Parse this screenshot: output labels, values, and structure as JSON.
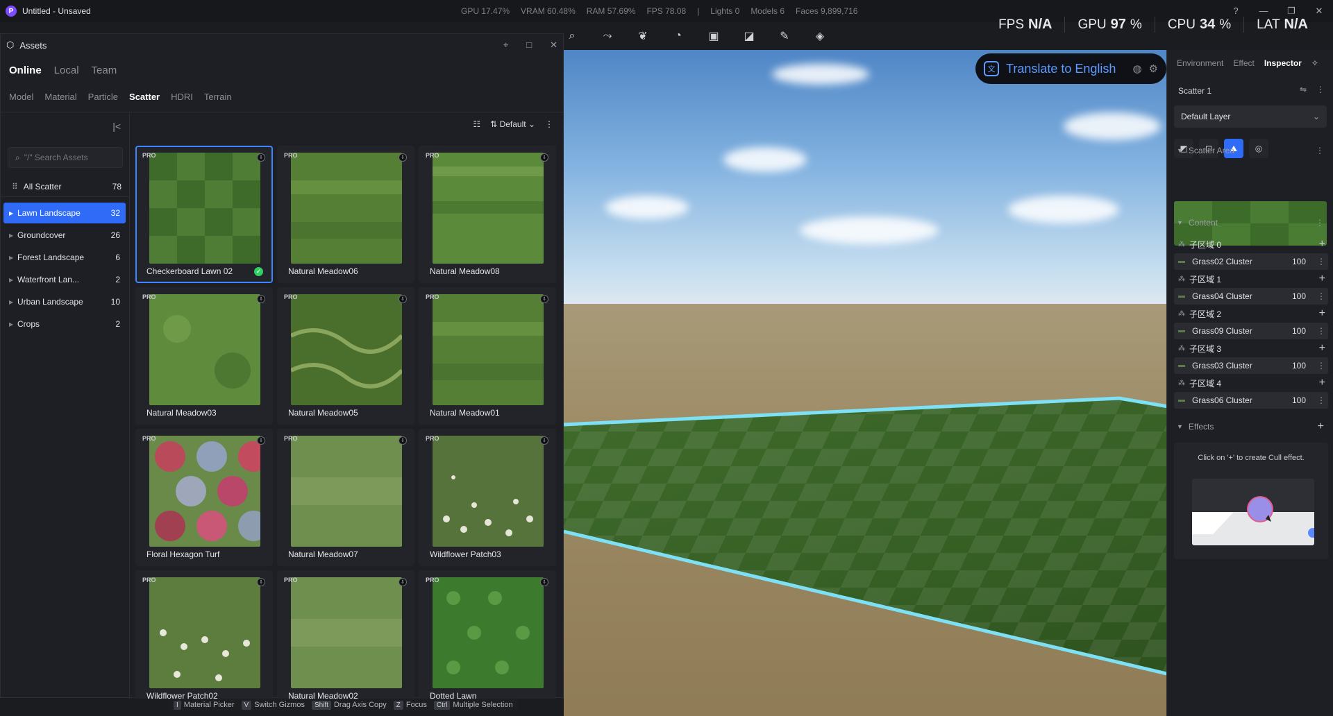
{
  "app": {
    "logo_letter": "P",
    "title": "Untitled - Unsaved"
  },
  "stats": [
    "GPU 17.47%",
    "VRAM 60.48%",
    "RAM 57.69%",
    "FPS 78.08",
    "|",
    "Lights 0",
    "Models 6",
    "Faces 9,899,716"
  ],
  "window_controls": {
    "help": "?",
    "minimize": "—",
    "restore": "❐",
    "close": "✕"
  },
  "perf": [
    {
      "label": "FPS",
      "value": "N/A",
      "unit": ""
    },
    {
      "label": "GPU",
      "value": "97",
      "unit": "%"
    },
    {
      "label": "CPU",
      "value": "34",
      "unit": "%"
    },
    {
      "label": "LAT",
      "value": "N/A",
      "unit": ""
    }
  ],
  "toolbar_icons": [
    "search-icon",
    "path-icon",
    "leaf-icon",
    "fire-icon",
    "camera-move-icon",
    "section-icon",
    "pen-icon",
    "layers-icon"
  ],
  "toolbar_glyphs": [
    "⌕",
    "⤳",
    "❦",
    "◔",
    "▣",
    "◪",
    "✎",
    "◈"
  ],
  "translate": {
    "label": "Translate to English",
    "icon": "文",
    "settings": "⚙",
    "globe": "◍"
  },
  "assets": {
    "title": "Assets",
    "source_tabs": [
      "Online",
      "Local",
      "Team"
    ],
    "active_source": "Online",
    "category_tabs": [
      "Model",
      "Material",
      "Particle",
      "Scatter",
      "HDRI",
      "Terrain"
    ],
    "active_category": "Scatter",
    "search_placeholder": "\"/\" Search Assets",
    "all": {
      "label": "All Scatter",
      "count": "78"
    },
    "categories": [
      {
        "label": "Lawn Landscape",
        "count": "32"
      },
      {
        "label": "Groundcover",
        "count": "26"
      },
      {
        "label": "Forest Landscape",
        "count": "6"
      },
      {
        "label": "Waterfront Lan...",
        "count": "2"
      },
      {
        "label": "Urban Landscape",
        "count": "10"
      },
      {
        "label": "Crops",
        "count": "2"
      }
    ],
    "sort_label": "Default",
    "items": [
      {
        "name": "Checkerboard Lawn 02",
        "badge": "PRO",
        "selected": true,
        "downloaded": true,
        "thumb": "checker"
      },
      {
        "name": "Natural Meadow06",
        "badge": "PRO",
        "thumb": "meadow"
      },
      {
        "name": "Natural Meadow08",
        "badge": "PRO",
        "thumb": "meadow2"
      },
      {
        "name": "Natural Meadow03",
        "badge": "PRO",
        "thumb": "meadow3"
      },
      {
        "name": "Natural Meadow05",
        "badge": "PRO",
        "thumb": "tuft"
      },
      {
        "name": "Natural Meadow01",
        "badge": "PRO",
        "thumb": "meadow"
      },
      {
        "name": "Floral Hexagon Turf",
        "badge": "PRO",
        "thumb": "floral"
      },
      {
        "name": "Natural Meadow07",
        "badge": "PRO",
        "thumb": "pale"
      },
      {
        "name": "Wildflower Patch03",
        "badge": "PRO",
        "thumb": "flowers"
      },
      {
        "name": "Wildflower Patch02",
        "badge": "PRO",
        "thumb": "flowers2"
      },
      {
        "name": "Natural Meadow02",
        "badge": "PRO",
        "thumb": "pale"
      },
      {
        "name": "Dotted Lawn",
        "badge": "PRO",
        "thumb": "dotted"
      }
    ]
  },
  "shortcuts": [
    {
      "key": "I",
      "label": "Material Picker"
    },
    {
      "key": "V",
      "label": "Switch Gizmos"
    },
    {
      "key": "Shift",
      "label": "Drag Axis Copy"
    },
    {
      "key": "Z",
      "label": "Focus"
    },
    {
      "key": "Ctrl",
      "label": "Multiple Selection"
    }
  ],
  "inspector": {
    "tabs": [
      "Environment",
      "Effect",
      "Inspector"
    ],
    "active_tab": "Inspector",
    "object_name": "Scatter 1",
    "layer": "Default Layer",
    "sections": {
      "area": "Scatter Area",
      "content": "Content",
      "effects": "Effects"
    },
    "zones": [
      {
        "zone": "子区域 0",
        "cluster": "Grass02 Cluster",
        "value": "100"
      },
      {
        "zone": "子区域 1",
        "cluster": "Grass04 Cluster",
        "value": "100"
      },
      {
        "zone": "子区域 2",
        "cluster": "Grass09 Cluster",
        "value": "100"
      },
      {
        "zone": "子区域 3",
        "cluster": "Grass03 Cluster",
        "value": "100"
      },
      {
        "zone": "子区域 4",
        "cluster": "Grass06 Cluster",
        "value": "100"
      }
    ],
    "effects_hint": "Click on '+' to create Cull effect."
  }
}
